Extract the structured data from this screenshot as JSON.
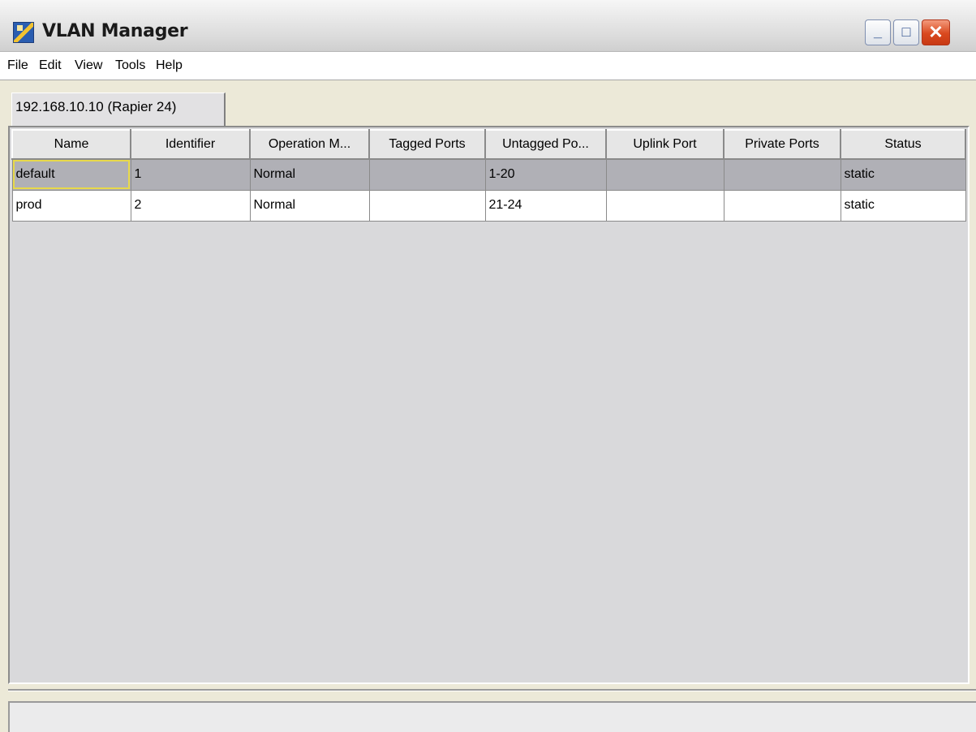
{
  "window": {
    "title": "VLAN Manager",
    "controls": {
      "minimize": "_",
      "maximize": "□",
      "close": "✕"
    }
  },
  "menu": [
    "File",
    "Edit",
    "View",
    "Tools",
    "Help"
  ],
  "tab": {
    "label": "192.168.10.10 (Rapier 24)"
  },
  "table": {
    "columns": [
      "Name",
      "Identifier",
      "Operation M...",
      "Tagged Ports",
      "Untagged Po...",
      "Uplink Port",
      "Private Ports",
      "Status"
    ],
    "rows": [
      {
        "selected": true,
        "cells": [
          "default",
          "1",
          "Normal",
          "",
          "1-20",
          "",
          "",
          "static"
        ]
      },
      {
        "selected": false,
        "cells": [
          "prod",
          "2",
          "Normal",
          "",
          "21-24",
          "",
          "",
          "static"
        ]
      }
    ]
  },
  "status_bar": {
    "text": ""
  }
}
